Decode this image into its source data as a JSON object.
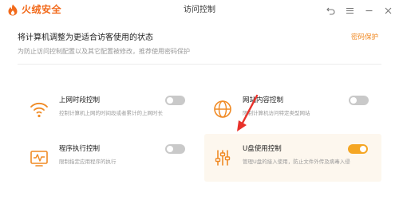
{
  "app": {
    "brand": "火绒安全",
    "window_title": "访问控制"
  },
  "window_controls": [
    "back-icon",
    "menu-icon",
    "minimize-icon",
    "close-icon"
  ],
  "header": {
    "title": "将计算机调整为更适合访客使用的状态",
    "subtitle": "为防止访问控制配置以及其它配置被修改，推荐使用密码保护",
    "password_link": "密码保护"
  },
  "colors": {
    "brand": "#f26a1b",
    "accent": "#f5a623",
    "link": "#f08a24",
    "toggle_off": "#c9c9c9"
  },
  "features": [
    {
      "title": "上网时段控制",
      "desc": "控制计算机上网的时间段或者累计的上网时长",
      "enabled": false,
      "icon": "wifi-icon"
    },
    {
      "title": "网站内容控制",
      "desc": "限制计算机访问特定类型网站",
      "enabled": false,
      "icon": "globe-icon"
    },
    {
      "title": "程序执行控制",
      "desc": "限制指定应用程序的执行",
      "enabled": false,
      "icon": "program-monitor-icon"
    },
    {
      "title": "U盘使用控制",
      "desc": "管理U盘的接入使用，防止文件外传及病毒入侵",
      "enabled": true,
      "icon": "sliders-icon"
    }
  ]
}
